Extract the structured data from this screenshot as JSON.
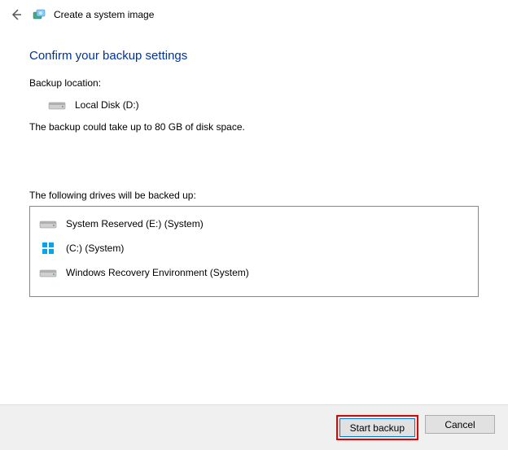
{
  "header": {
    "title": "Create a system image"
  },
  "page": {
    "title": "Confirm your backup settings",
    "backup_location_label": "Backup location:",
    "backup_location_value": "Local Disk (D:)",
    "size_info": "The backup could take up to 80 GB of disk space.",
    "drives_label": "The following drives will be backed up:"
  },
  "drives": [
    {
      "label": "System Reserved (E:) (System)",
      "icon": "disk"
    },
    {
      "label": "(C:) (System)",
      "icon": "windows"
    },
    {
      "label": "Windows Recovery Environment (System)",
      "icon": "disk"
    }
  ],
  "footer": {
    "start_label": "Start backup",
    "cancel_label": "Cancel"
  }
}
